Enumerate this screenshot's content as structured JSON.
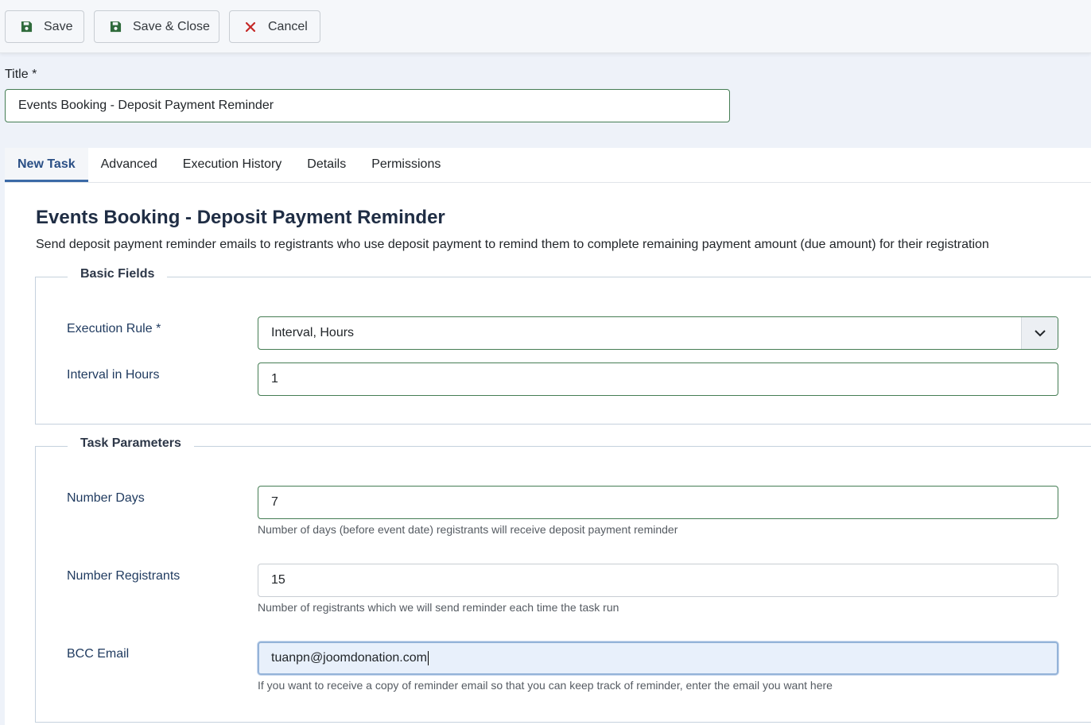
{
  "toolbar": {
    "save_label": "Save",
    "save_close_label": "Save & Close",
    "cancel_label": "Cancel",
    "save_color": "#2f6b3b",
    "cancel_color": "#c52827"
  },
  "title_field": {
    "label": "Title *",
    "value": "Events Booking - Deposit Payment Reminder"
  },
  "tabs": [
    {
      "label": "New Task",
      "active": true
    },
    {
      "label": "Advanced",
      "active": false
    },
    {
      "label": "Execution History",
      "active": false
    },
    {
      "label": "Details",
      "active": false
    },
    {
      "label": "Permissions",
      "active": false
    }
  ],
  "task": {
    "title": "Events Booking - Deposit Payment Reminder",
    "description": "Send deposit payment reminder emails to registrants who use deposit payment to remind them to complete remaining payment amount (due amount) for their registration"
  },
  "basic_fields": {
    "legend": "Basic Fields",
    "execution_rule": {
      "label": "Execution Rule *",
      "value": "Interval, Hours"
    },
    "interval_hours": {
      "label": "Interval in Hours",
      "value": "1"
    }
  },
  "task_parameters": {
    "legend": "Task Parameters",
    "number_days": {
      "label": "Number Days",
      "value": "7",
      "help": "Number of days (before event date) registrants will receive deposit payment reminder"
    },
    "number_registrants": {
      "label": "Number Registrants",
      "value": "15",
      "help": "Number of registrants which we will send reminder each time the task run"
    },
    "bcc_email": {
      "label": "BCC Email",
      "value": "tuanpn@joomdonation.com",
      "help": "If you want to receive a copy of reminder email so that you can keep track of reminder, enter the email you want here"
    }
  }
}
